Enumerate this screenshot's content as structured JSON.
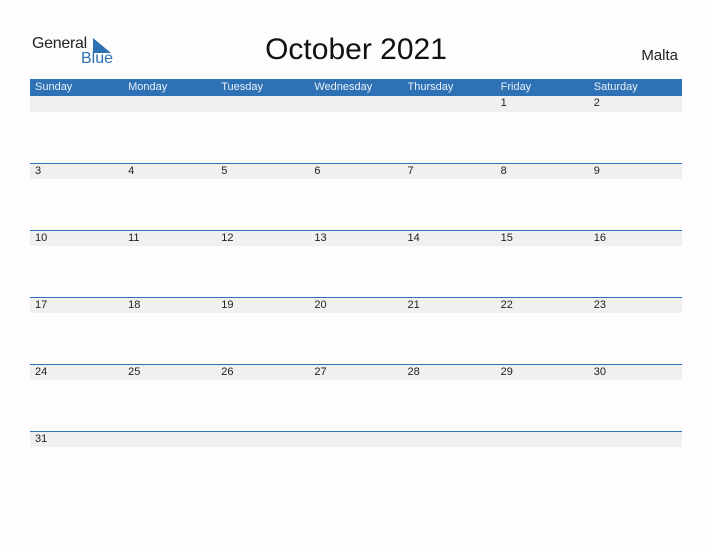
{
  "logo": {
    "general": "General",
    "blue": "Blue"
  },
  "title": "October 2021",
  "country": "Malta",
  "weekdays": [
    "Sunday",
    "Monday",
    "Tuesday",
    "Wednesday",
    "Thursday",
    "Friday",
    "Saturday"
  ],
  "weeks": [
    [
      "",
      "",
      "",
      "",
      "",
      "1",
      "2"
    ],
    [
      "3",
      "4",
      "5",
      "6",
      "7",
      "8",
      "9"
    ],
    [
      "10",
      "11",
      "12",
      "13",
      "14",
      "15",
      "16"
    ],
    [
      "17",
      "18",
      "19",
      "20",
      "21",
      "22",
      "23"
    ],
    [
      "24",
      "25",
      "26",
      "27",
      "28",
      "29",
      "30"
    ],
    [
      "31",
      "",
      "",
      "",
      "",
      "",
      ""
    ]
  ],
  "colors": {
    "accent": "#2e72b5",
    "strip": "#f0f0f0"
  }
}
